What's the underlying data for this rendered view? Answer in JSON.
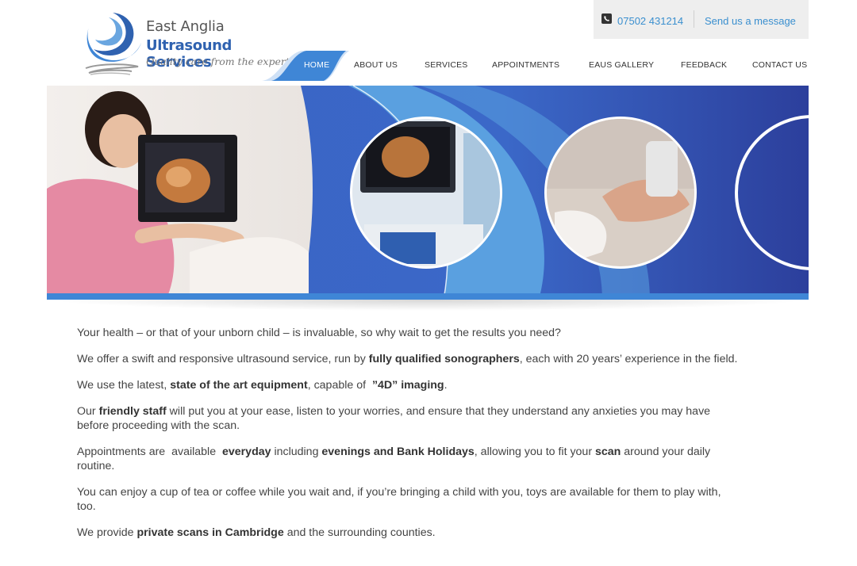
{
  "logo": {
    "line1": "East Anglia",
    "line2": "Ultrasound Services",
    "tagline": "Quality care from the experts"
  },
  "contact": {
    "phone": "07502 431214",
    "message_link": "Send us a message",
    "icon": "phone-icon"
  },
  "nav": {
    "items": [
      {
        "label": "HOME",
        "active": true
      },
      {
        "label": "ABOUT US"
      },
      {
        "label": "SERVICES"
      },
      {
        "label": "APPOINTMENTS"
      },
      {
        "label": "EAUS GALLERY"
      },
      {
        "label": "FEEDBACK"
      },
      {
        "label": "CONTACT US"
      }
    ]
  },
  "colors": {
    "brand_blue": "#2f62b0",
    "link_blue": "#3a8fcf",
    "banner_dark": "#3b5fc0",
    "banner_light": "#5aa0e0"
  },
  "content": {
    "p1": "Your health – or that of your unborn child – is invaluable, so why wait to get the results you need?",
    "p2_a": "We offer a swift and responsive ultrasound service, run by ",
    "p2_b": "fully qualified sonographers",
    "p2_c": ", each with 20 years’ experience in the field.",
    "p3_a": "We use the latest, ",
    "p3_b": "state of the art equipment",
    "p3_c": ", capable of  ",
    "p3_d": "”4D” imaging",
    "p3_e": ".",
    "p4_a": "Our ",
    "p4_b": "friendly staff",
    "p4_c": " will put you at your ease, listen to your worries, and ensure that they understand any anxieties you may have before proceeding with the scan.",
    "p5_a": "Appointments are  available  ",
    "p5_b": "everyday",
    "p5_c": " including ",
    "p5_d": "evenings and Bank Holidays",
    "p5_e": ", allowing you to fit your ",
    "p5_f": "scan",
    "p5_g": " around your daily routine.",
    "p6": "You can enjoy a cup of tea or coffee while you wait and, if you’re bringing a child with you, toys are available for them to play with, too.",
    "p7_a": "We provide ",
    "p7_b": "private scans in Cambridge",
    "p7_c": " and the surrounding counties."
  }
}
